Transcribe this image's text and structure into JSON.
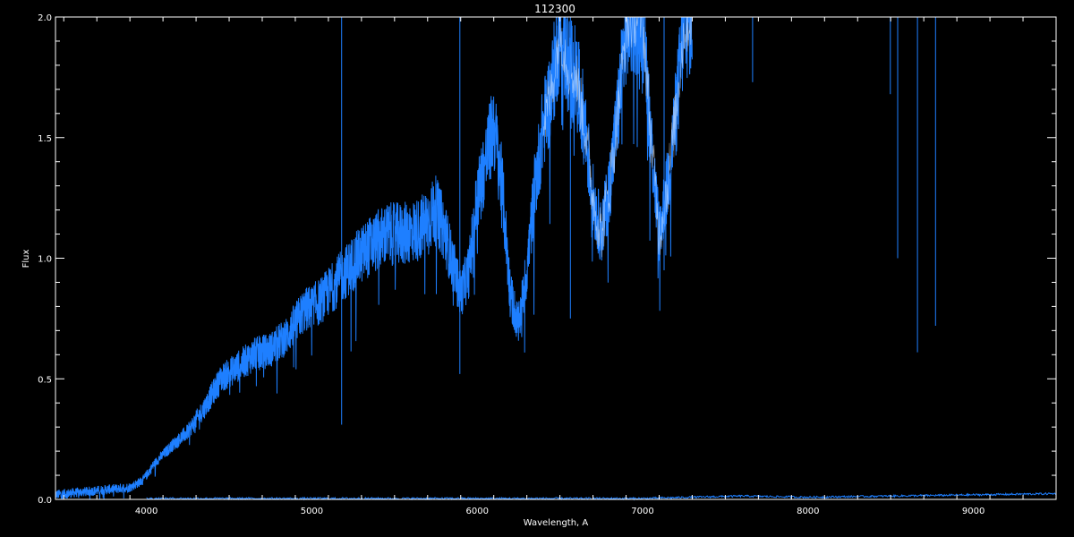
{
  "colors": {
    "background": "#000000",
    "axes": "#ffffff",
    "flux_series": "#1e7fff",
    "overlay_series": "#ffffff"
  },
  "chart_data": {
    "type": "line",
    "title": "112300",
    "xlabel": "Wavelength, A",
    "ylabel": "Flux",
    "xlim": [
      3450,
      9500
    ],
    "ylim": [
      0.0,
      2.0
    ],
    "x_ticks": [
      4000,
      5000,
      6000,
      7000,
      8000,
      9000
    ],
    "x_tick_labels": [
      "4000",
      "5000",
      "6000",
      "7000",
      "8000",
      "9000"
    ],
    "y_ticks": [
      0.0,
      0.5,
      1.0,
      1.5,
      2.0
    ],
    "y_tick_labels": [
      "0.0",
      "0.5",
      "1.0",
      "1.5",
      "2.0"
    ],
    "grid": false,
    "legend": "none",
    "series": [
      {
        "x": [
          3450,
          3600,
          3750,
          3900,
          3980,
          4050,
          4150,
          4250,
          4350,
          4450,
          4550,
          4650,
          4750,
          4850,
          4950,
          5050,
          5150,
          5250,
          5350,
          5450,
          5550,
          5650,
          5750,
          5800,
          5850,
          5900,
          5950,
          6000,
          6050,
          6100,
          6150,
          6200,
          6250,
          6300,
          6350,
          6400,
          6450,
          6500,
          6550,
          6600,
          6650,
          6700,
          6750,
          6800,
          6850,
          6900,
          6950,
          7000,
          7050,
          7100,
          7150,
          7200,
          7250,
          7300
        ],
        "values": [
          0.02,
          0.03,
          0.04,
          0.05,
          0.08,
          0.15,
          0.22,
          0.28,
          0.38,
          0.5,
          0.55,
          0.6,
          0.62,
          0.68,
          0.78,
          0.82,
          0.9,
          0.98,
          1.05,
          1.1,
          1.1,
          1.12,
          1.2,
          1.12,
          0.98,
          0.85,
          0.95,
          1.25,
          1.4,
          1.55,
          1.3,
          0.85,
          0.72,
          0.95,
          1.3,
          1.55,
          1.7,
          1.95,
          1.8,
          1.75,
          1.55,
          1.25,
          1.1,
          1.3,
          1.6,
          1.95,
          2.0,
          2.0,
          1.5,
          1.1,
          1.3,
          1.6,
          1.95,
          2.0
        ]
      },
      {
        "x": [
          4000,
          5000,
          6000,
          7000,
          7600,
          8000,
          8500,
          9000,
          9500
        ],
        "values": [
          0.0,
          0.0,
          0.0,
          0.0,
          0.01,
          0.005,
          0.01,
          0.015,
          0.02
        ]
      }
    ],
    "absorption_features": [
      {
        "x": 5180,
        "y": 0.31
      },
      {
        "x": 5895,
        "y": 0.52
      },
      {
        "x": 6563,
        "y": 0.75
      },
      {
        "x": 7130,
        "y": 0.95
      },
      {
        "x": 8498,
        "y": 1.68
      },
      {
        "x": 8542,
        "y": 1.0
      },
      {
        "x": 8662,
        "y": 0.61
      },
      {
        "x": 8771,
        "y": 0.72
      },
      {
        "x": 7665,
        "y": 1.73
      }
    ]
  }
}
